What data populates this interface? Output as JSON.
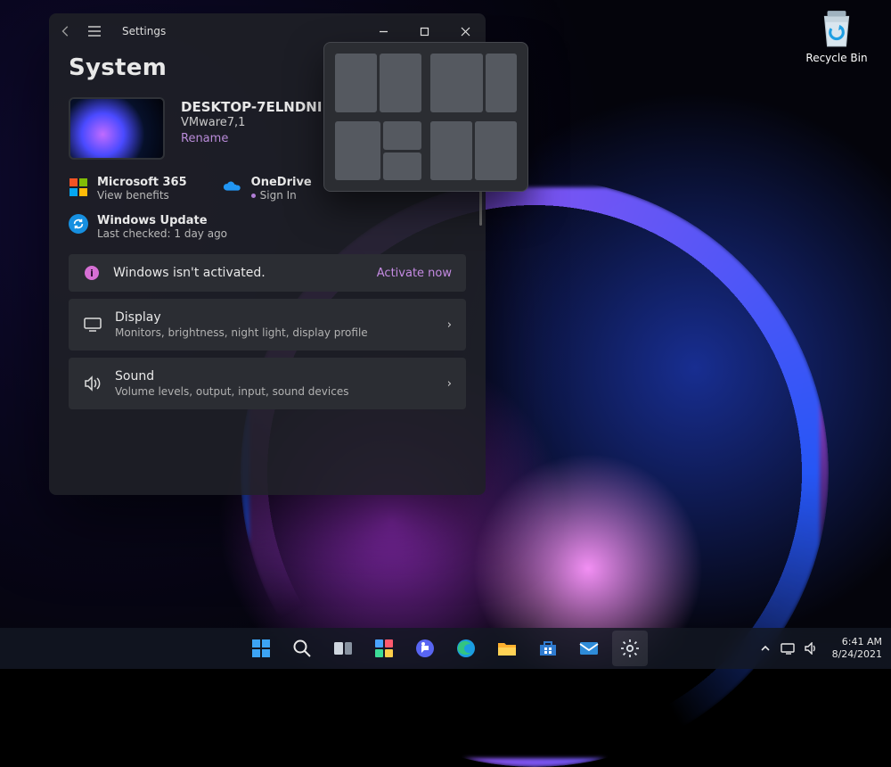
{
  "desktop": {
    "recycle_bin_label": "Recycle Bin"
  },
  "window": {
    "title": "Settings",
    "page_heading": "System",
    "device": {
      "name": "DESKTOP-7ELNDNI",
      "platform": "VMware7,1",
      "rename_label": "Rename"
    },
    "quicklinks": {
      "m365_title": "Microsoft 365",
      "m365_sub": "View benefits",
      "onedrive_title": "OneDrive",
      "onedrive_sub": "Sign In"
    },
    "update": {
      "title": "Windows Update",
      "subtitle": "Last checked: 1 day ago"
    },
    "activation": {
      "message": "Windows isn't activated.",
      "action": "Activate now"
    },
    "items": [
      {
        "title": "Display",
        "subtitle": "Monitors, brightness, night light, display profile",
        "icon": "display-icon"
      },
      {
        "title": "Sound",
        "subtitle": "Volume levels, output, input, sound devices",
        "icon": "sound-icon"
      }
    ]
  },
  "snap_layouts": {
    "options": [
      "two-even",
      "two-wide-left",
      "three-left-big",
      "four-grid"
    ]
  },
  "taskbar": {
    "items": [
      "start",
      "search",
      "taskview",
      "widgets",
      "chat",
      "edge",
      "explorer",
      "store",
      "mail",
      "settings"
    ],
    "time": "6:41 AM",
    "date": "8/24/2021"
  },
  "colors": {
    "accent_link": "#c58be3",
    "card_bg": "#2b2d33",
    "window_bg": "rgba(30,32,38,0.92)"
  }
}
